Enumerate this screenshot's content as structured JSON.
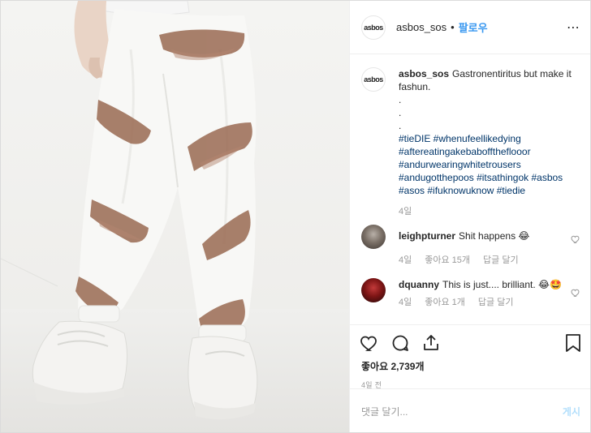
{
  "post": {
    "account": "asbos_sos",
    "logo_text": "asbos",
    "separator": "•",
    "follow_label": "팔로우",
    "more_label": "⋯"
  },
  "caption": {
    "user": "asbos_sos",
    "text": "Gastronentiritus but make it fashun.",
    "dots": [
      ".",
      ".",
      "."
    ],
    "hashtag_lines": [
      "#tieDIE #whenufeellikedying",
      "#aftereatingakebabofftheflooor",
      "#andurwearingwhitetrousers",
      "#andugotthepoos #itsathingok #asbos",
      "#asos #ifuknowuknow #tiedie"
    ],
    "age": "4일"
  },
  "comments": [
    {
      "user": "leighpturner",
      "text": "Shit happens 😂",
      "age": "4일",
      "likes": "좋아요 15개",
      "reply": "답글 달기"
    },
    {
      "user": "dquanny",
      "text": "This is just.... brilliant. 😂🤩",
      "age": "4일",
      "likes": "좋아요 1개",
      "reply": "답글 달기"
    }
  ],
  "engagement": {
    "likes_text": "좋아요 2,739개",
    "posted_ago": "4일 전"
  },
  "composer": {
    "placeholder": "댓글 달기...",
    "post_label": "게시"
  },
  "colors": {
    "link": "#3897f0",
    "hashtag": "#003569",
    "post_disabled": "#b2dffc",
    "dye": "#9a6a52"
  }
}
